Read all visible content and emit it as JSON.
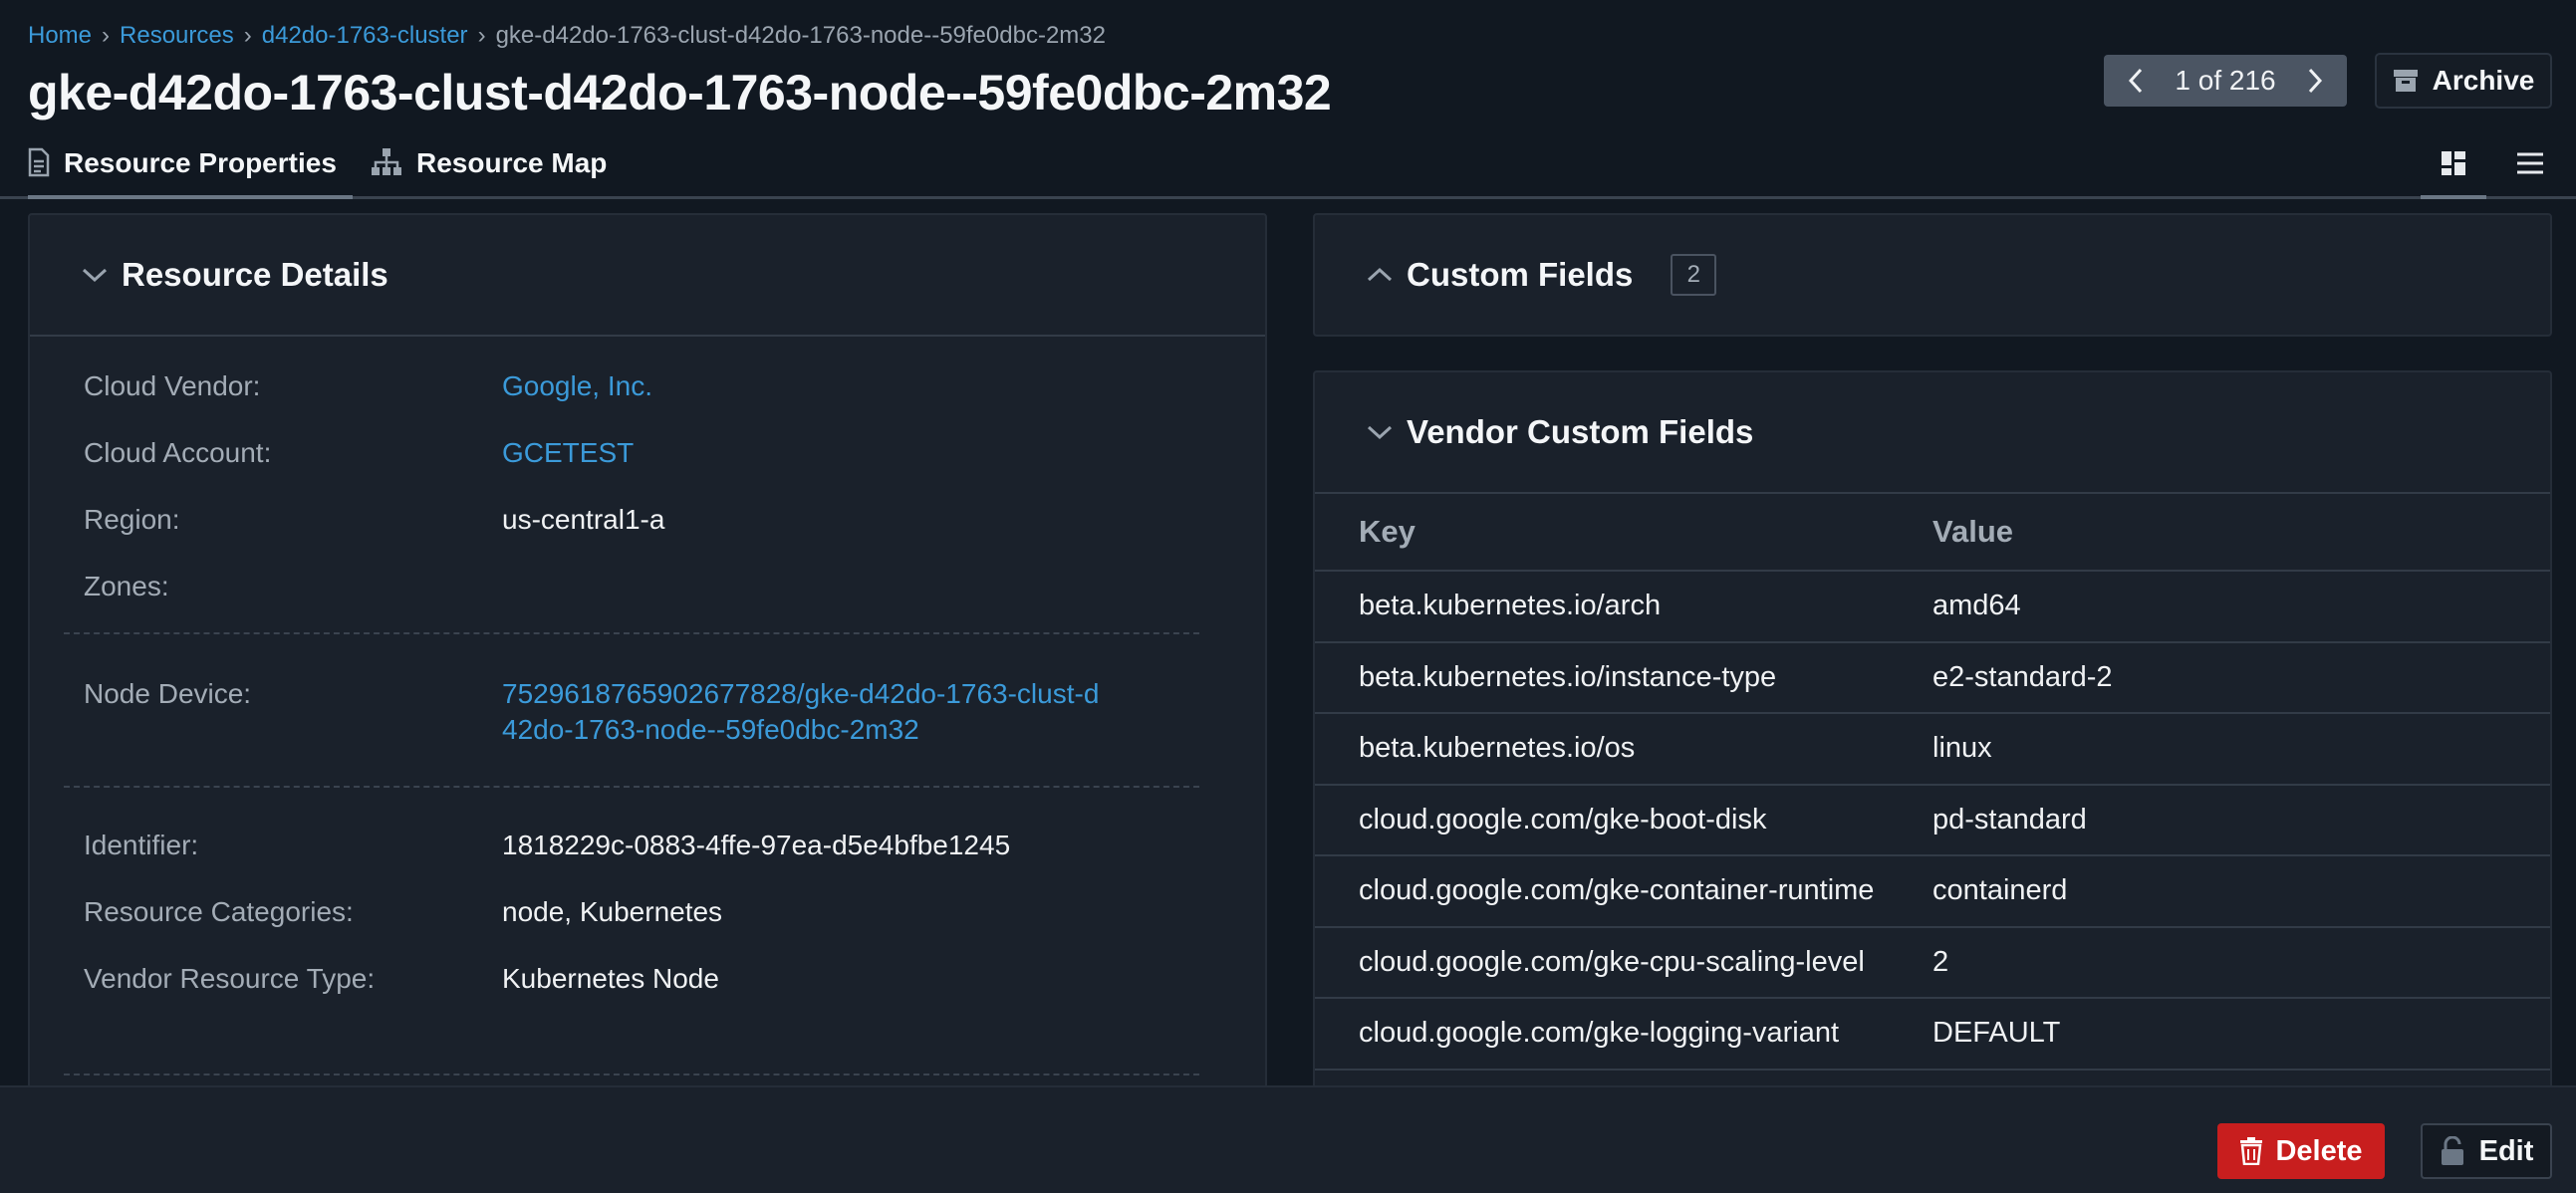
{
  "breadcrumb": {
    "items": [
      "Home",
      "Resources",
      "d42do-1763-cluster"
    ],
    "current": "gke-d42do-1763-clust-d42do-1763-node--59fe0dbc-2m32",
    "separator": "›"
  },
  "page_title": "gke-d42do-1763-clust-d42do-1763-node--59fe0dbc-2m32",
  "pager": {
    "label": "1 of 216"
  },
  "archive_label": "Archive",
  "tabs": [
    {
      "label": "Resource Properties",
      "icon": "document-icon",
      "active": true
    },
    {
      "label": "Resource Map",
      "icon": "sitemap-icon",
      "active": false
    }
  ],
  "view_toggle": {
    "active": "grid"
  },
  "resource_details": {
    "title": "Resource Details",
    "rows": [
      {
        "label": "Cloud Vendor:",
        "value": "Google, Inc.",
        "link": true
      },
      {
        "label": "Cloud Account:",
        "value": "GCETEST",
        "link": true
      },
      {
        "label": "Region:",
        "value": "us-central1-a",
        "link": false
      },
      {
        "label": "Zones:",
        "value": "",
        "link": false
      },
      {
        "label": "Node Device:",
        "value": "7529618765902677828/gke-d42do-1763-clust-d42do-1763-node--59fe0dbc-2m32",
        "link": true
      },
      {
        "label": "Identifier:",
        "value": "1818229c-0883-4ffe-97ea-d5e4bfbe1245",
        "link": false
      },
      {
        "label": "Resource Categories:",
        "value": "node, Kubernetes",
        "link": false
      },
      {
        "label": "Vendor Resource Type:",
        "value": "Kubernetes Node",
        "link": false
      }
    ]
  },
  "custom_fields": {
    "title": "Custom Fields",
    "count": "2"
  },
  "vendor_custom_fields": {
    "title": "Vendor Custom Fields",
    "columns": [
      "Key",
      "Value"
    ],
    "rows": [
      [
        "beta.kubernetes.io/arch",
        "amd64"
      ],
      [
        "beta.kubernetes.io/instance-type",
        "e2-standard-2"
      ],
      [
        "beta.kubernetes.io/os",
        "linux"
      ],
      [
        "cloud.google.com/gke-boot-disk",
        "pd-standard"
      ],
      [
        "cloud.google.com/gke-container-runtime",
        "containerd"
      ],
      [
        "cloud.google.com/gke-cpu-scaling-level",
        "2"
      ],
      [
        "cloud.google.com/gke-logging-variant",
        "DEFAULT"
      ]
    ]
  },
  "footer": {
    "delete_label": "Delete",
    "edit_label": "Edit"
  },
  "colors": {
    "accent_link": "#3b9ad9",
    "danger": "#c81e1e",
    "background": "#111821",
    "panel": "#1a212b"
  }
}
